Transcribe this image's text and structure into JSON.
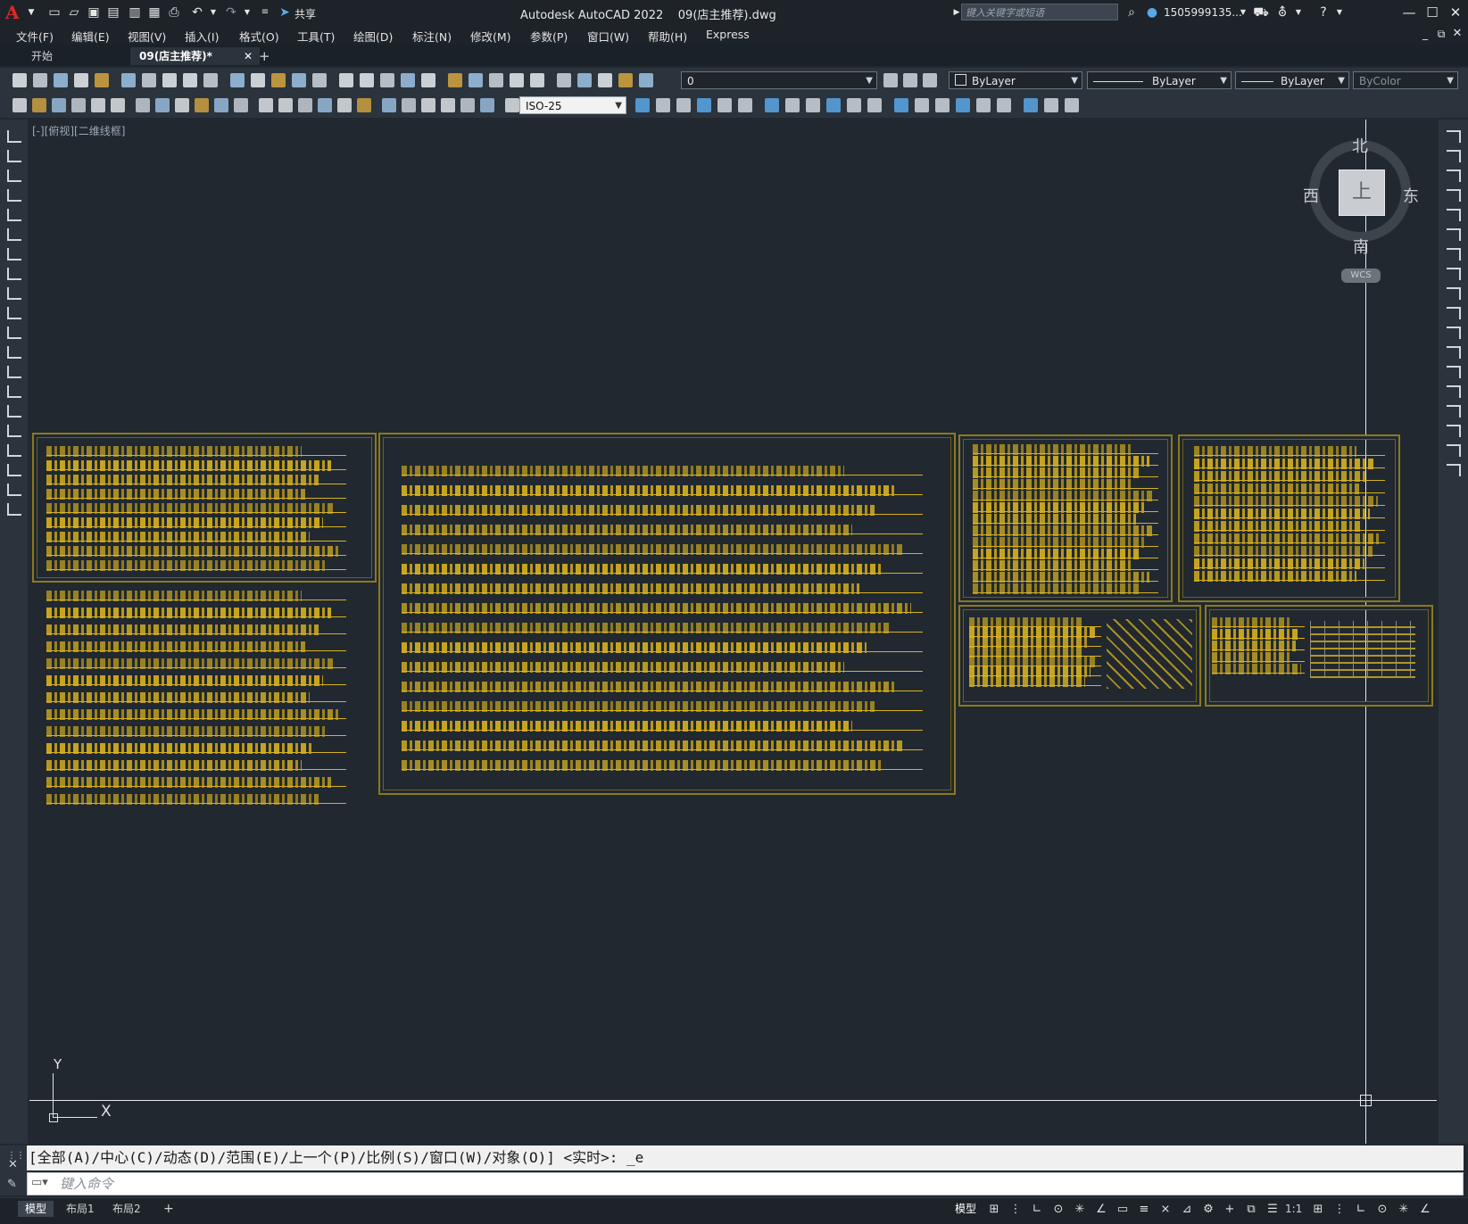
{
  "titlebar": {
    "app_title": "Autodesk AutoCAD 2022    09(店主推荐).dwg",
    "share_label": "共享",
    "search_placeholder": "键入关键字或短语",
    "user_name": "1505999135...",
    "logo_letter": "A"
  },
  "menu": {
    "items": [
      "文件(F)",
      "编辑(E)",
      "视图(V)",
      "插入(I)",
      "格式(O)",
      "工具(T)",
      "绘图(D)",
      "标注(N)",
      "修改(M)",
      "参数(P)",
      "窗口(W)",
      "帮助(H)",
      "Express"
    ]
  },
  "tabs": {
    "start": "开始",
    "active": "09(店主推荐)*",
    "close": "✕",
    "add": "+"
  },
  "toolbar": {
    "layer_value": "0",
    "color_value": "ByLayer",
    "linetype_value": "ByLayer",
    "lineweight_value": "ByLayer",
    "plotstyle_value": "ByColor",
    "dimstyle_value": "ISO-25"
  },
  "viewport": {
    "label": "[-][俯视][二维线框]"
  },
  "viewcube": {
    "north": "北",
    "south": "南",
    "east": "东",
    "west": "西",
    "face": "上",
    "wcs": "WCS"
  },
  "ucs": {
    "x_label": "X",
    "y_label": "Y"
  },
  "command": {
    "history": "[全部(A)/中心(C)/动态(D)/范围(E)/上一个(P)/比例(S)/窗口(W)/对象(O)] <实时>: _e",
    "input_placeholder": "键入命令"
  },
  "layout_tabs": [
    "模型",
    "布局1",
    "布局2"
  ],
  "layout_add": "+",
  "status": {
    "model_label": "模型",
    "scale_label": "1:1"
  },
  "colors": {
    "drawing_yellow": "#d8b21e",
    "frame_olive": "#8a7a1e",
    "background": "#212830"
  }
}
